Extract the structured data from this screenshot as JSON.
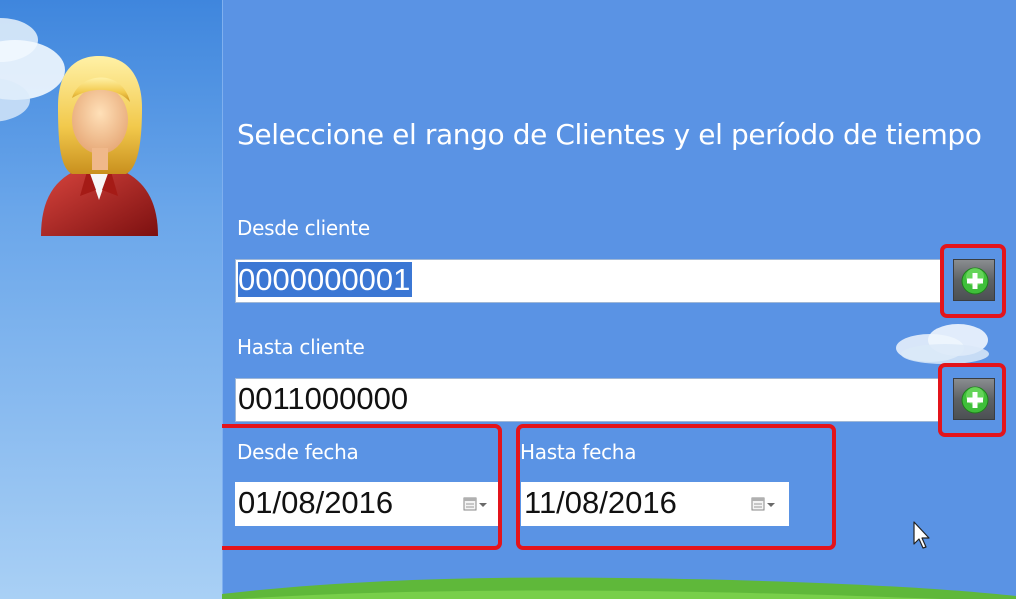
{
  "header": {
    "title": "Seleccione el rango de Clientes y el período de tiempo"
  },
  "form": {
    "from_client": {
      "label": "Desde cliente",
      "value": "0000000001",
      "value_selected": true
    },
    "to_client": {
      "label": "Hasta cliente",
      "value": "0011000000"
    },
    "from_date": {
      "label": "Desde fecha",
      "value": "01/08/2016"
    },
    "to_date": {
      "label": "Hasta fecha",
      "value": "11/08/2016"
    }
  },
  "icons": {
    "avatar": "user-avatar-icon",
    "add": "plus-icon",
    "calendar": "calendar-dropdown-icon",
    "cursor": "mouse-pointer-icon"
  },
  "colors": {
    "background": "#5a93e4",
    "highlight": "#e3141b",
    "selection": "#3b77d4",
    "add_button": "#5e6265",
    "plus": "#3fbf3a"
  }
}
